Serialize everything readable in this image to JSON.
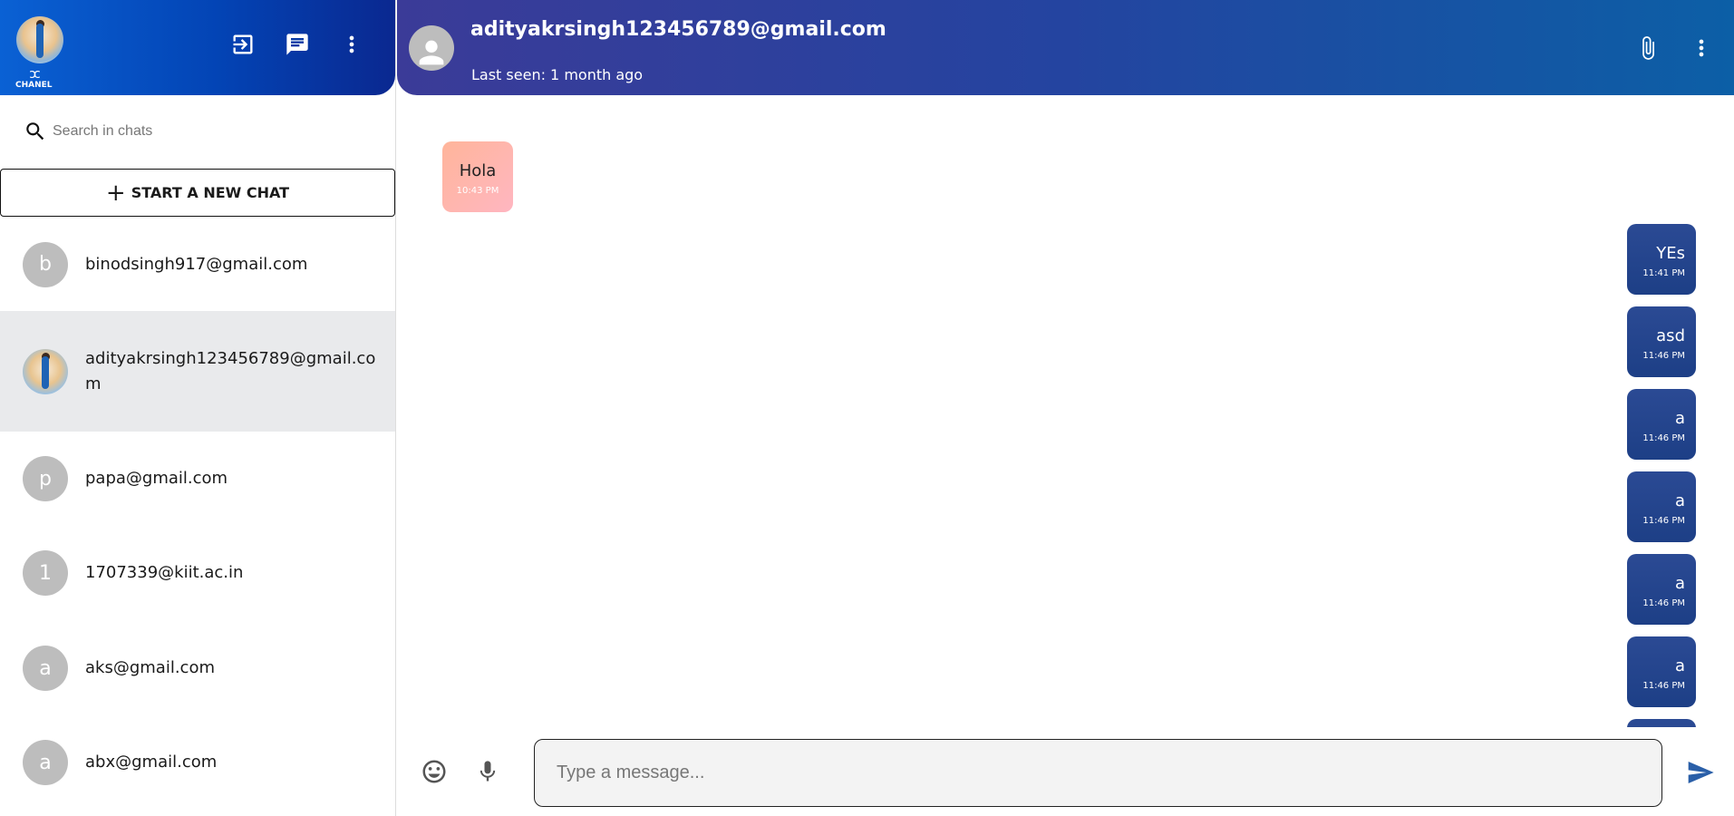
{
  "sidebar": {
    "profile": {
      "brand_text": "CHANEL"
    },
    "icons": [
      "exit-icon",
      "chat-icon",
      "more-vert-icon"
    ],
    "search": {
      "placeholder": "Search in chats"
    },
    "new_chat_label": "START A NEW CHAT",
    "chats": [
      {
        "initial": "b",
        "name": "binodsingh917@gmail.com",
        "active": false
      },
      {
        "initial": "",
        "name": "adityakrsingh123456789@gmail.com",
        "active": true,
        "photo": true
      },
      {
        "initial": "p",
        "name": "papa@gmail.com",
        "active": false
      },
      {
        "initial": "1",
        "name": "1707339@kiit.ac.in",
        "active": false
      },
      {
        "initial": "a",
        "name": "aks@gmail.com",
        "active": false
      },
      {
        "initial": "a",
        "name": "abx@gmail.com",
        "active": false
      }
    ]
  },
  "conversation": {
    "contact_name": "adityakrsingh123456789@gmail.com",
    "last_seen": "Last seen: 1 month ago",
    "header_icons": [
      "attach-icon",
      "more-vert-icon"
    ],
    "messages": [
      {
        "direction": "in",
        "text": "Hola",
        "time": "10:43 PM"
      },
      {
        "direction": "out",
        "text": "YEs",
        "time": "11:41 PM"
      },
      {
        "direction": "out",
        "text": "asd",
        "time": "11:46 PM"
      },
      {
        "direction": "out",
        "text": "a",
        "time": "11:46 PM"
      },
      {
        "direction": "out",
        "text": "a",
        "time": "11:46 PM"
      },
      {
        "direction": "out",
        "text": "a",
        "time": "11:46 PM"
      },
      {
        "direction": "out",
        "text": "a",
        "time": "11:46 PM"
      }
    ],
    "composer": {
      "placeholder": "Type a message...",
      "icons": [
        "emoji-icon",
        "mic-icon",
        "send-icon"
      ]
    }
  },
  "colors": {
    "sidebar_header": "#0344b5",
    "main_header": "#2444a0",
    "outgoing_bubble": "#1d3f86",
    "incoming_bubble": "#ffb6c1",
    "active_chat": "#e9eaec",
    "send_icon": "#2a5fa8"
  }
}
